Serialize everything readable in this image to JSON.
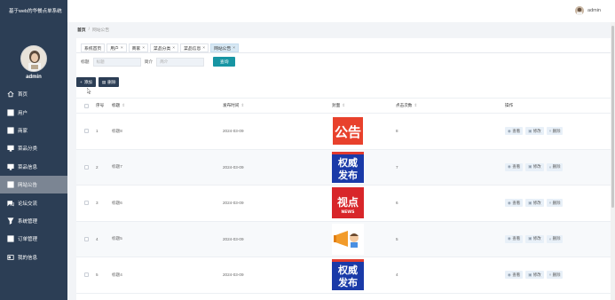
{
  "app": {
    "title": "基于web的华餐点单系统",
    "user": "admin"
  },
  "sidebar": {
    "items": [
      {
        "label": "首页",
        "icon": "home-icon",
        "active": false
      },
      {
        "label": "用户",
        "icon": "grid-icon",
        "active": false
      },
      {
        "label": "商家",
        "icon": "grid-icon",
        "active": false
      },
      {
        "label": "菜品分类",
        "icon": "monitor-icon",
        "active": false
      },
      {
        "label": "菜品信息",
        "icon": "monitor-icon",
        "active": false
      },
      {
        "label": "网站公告",
        "icon": "grid-icon",
        "active": true
      },
      {
        "label": "论坛交流",
        "icon": "chat-icon",
        "active": false
      },
      {
        "label": "系统管理",
        "icon": "pin-icon",
        "active": false
      },
      {
        "label": "订单管理",
        "icon": "grid-icon",
        "active": false
      },
      {
        "label": "我的信息",
        "icon": "card-icon",
        "active": false
      }
    ]
  },
  "breadcrumb": {
    "home": "首页",
    "separator": "/",
    "current": "网站公告"
  },
  "tabs": [
    {
      "label": "系统首页",
      "closable": false,
      "active": false
    },
    {
      "label": "用户",
      "closable": true,
      "active": false
    },
    {
      "label": "商家",
      "closable": true,
      "active": false
    },
    {
      "label": "菜品分类",
      "closable": true,
      "active": false
    },
    {
      "label": "菜品信息",
      "closable": true,
      "active": false
    },
    {
      "label": "网站公告",
      "closable": true,
      "active": true
    }
  ],
  "search": {
    "title_label": "标题",
    "title_placeholder": "标题",
    "intro_label": "简介",
    "intro_placeholder": "简介",
    "button": "查询"
  },
  "actions": {
    "add": "添加",
    "delete": "删除"
  },
  "table": {
    "headers": {
      "index": "序号",
      "title": "标题",
      "date": "发布时间",
      "cover": "封面",
      "clicks": "点击次数",
      "ops": "操作"
    },
    "op_labels": {
      "view": "查看",
      "edit": "修改",
      "delete": "删除"
    },
    "rows": [
      {
        "index": "1",
        "title": "标题8",
        "date": "2024-03-09",
        "clicks": "8",
        "cover": "gonggao-image"
      },
      {
        "index": "2",
        "title": "标题7",
        "date": "2024-03-09",
        "clicks": "7",
        "cover": "quanwei-fabu-image"
      },
      {
        "index": "3",
        "title": "标题6",
        "date": "2024-03-09",
        "clicks": "6",
        "cover": "shidian-news-image"
      },
      {
        "index": "4",
        "title": "标题5",
        "date": "2024-03-09",
        "clicks": "5",
        "cover": "megaphone-image"
      },
      {
        "index": "5",
        "title": "标题4",
        "date": "2024-03-09",
        "clicks": "4",
        "cover": "quanwei-fabu-image"
      }
    ]
  },
  "cover_text": {
    "gonggao": "公告",
    "quanwei_1": "权威",
    "quanwei_2": "发布",
    "shidian": "视点",
    "news": "NEWS"
  },
  "colors": {
    "sidebar": "#2c3e55",
    "accent": "#1795a3",
    "active_nav": "#7b8593",
    "active_tab": "#d7e8f4"
  }
}
